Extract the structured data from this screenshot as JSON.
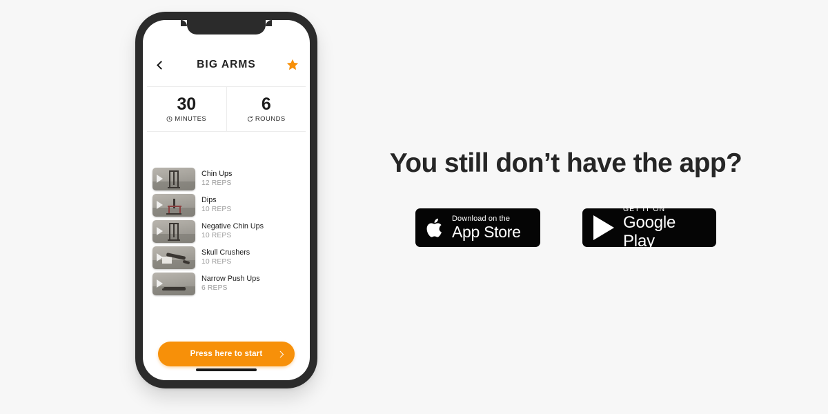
{
  "page": {
    "background_color": "#f7f7f7",
    "accent_color": "#f79009",
    "text_color": "#262626"
  },
  "phone": {
    "frame_color": "#2b2b2b",
    "screen_color": "#ffffff",
    "app": {
      "header": {
        "back_icon": "chevron-left-icon",
        "title": "BIG ARMS",
        "favorite_icon": "star-icon",
        "favorite_color": "#f79009"
      },
      "stats": [
        {
          "value": "30",
          "label": "MINUTES",
          "icon": "clock-icon"
        },
        {
          "value": "6",
          "label": "ROUNDS",
          "icon": "refresh-icon"
        }
      ],
      "exercises": [
        {
          "name": "Chin Ups",
          "reps": "12 REPS",
          "play_icon": "play-icon",
          "pose": "pullup"
        },
        {
          "name": "Dips",
          "reps": "10 REPS",
          "play_icon": "play-icon",
          "pose": "dip"
        },
        {
          "name": "Negative Chin Ups",
          "reps": "10 REPS",
          "play_icon": "play-icon",
          "pose": "pullup"
        },
        {
          "name": "Skull Crushers",
          "reps": "10 REPS",
          "play_icon": "play-icon",
          "pose": "bench"
        },
        {
          "name": "Narrow Push Ups",
          "reps": "6 REPS",
          "play_icon": "play-icon",
          "pose": "pushup"
        }
      ],
      "start_button": {
        "label": "Press here to start",
        "arrow_icon": "chevron-right-icon",
        "color": "#f79009"
      }
    }
  },
  "promo": {
    "headline": "You still don’t have the app?",
    "badges": [
      {
        "id": "app-store",
        "icon": "apple-logo-icon",
        "small_text": "Download on the",
        "big_text": "App Store"
      },
      {
        "id": "google-play",
        "icon": "google-play-triangle-icon",
        "small_text": "GET IT ON",
        "big_text": "Google Play"
      }
    ]
  }
}
